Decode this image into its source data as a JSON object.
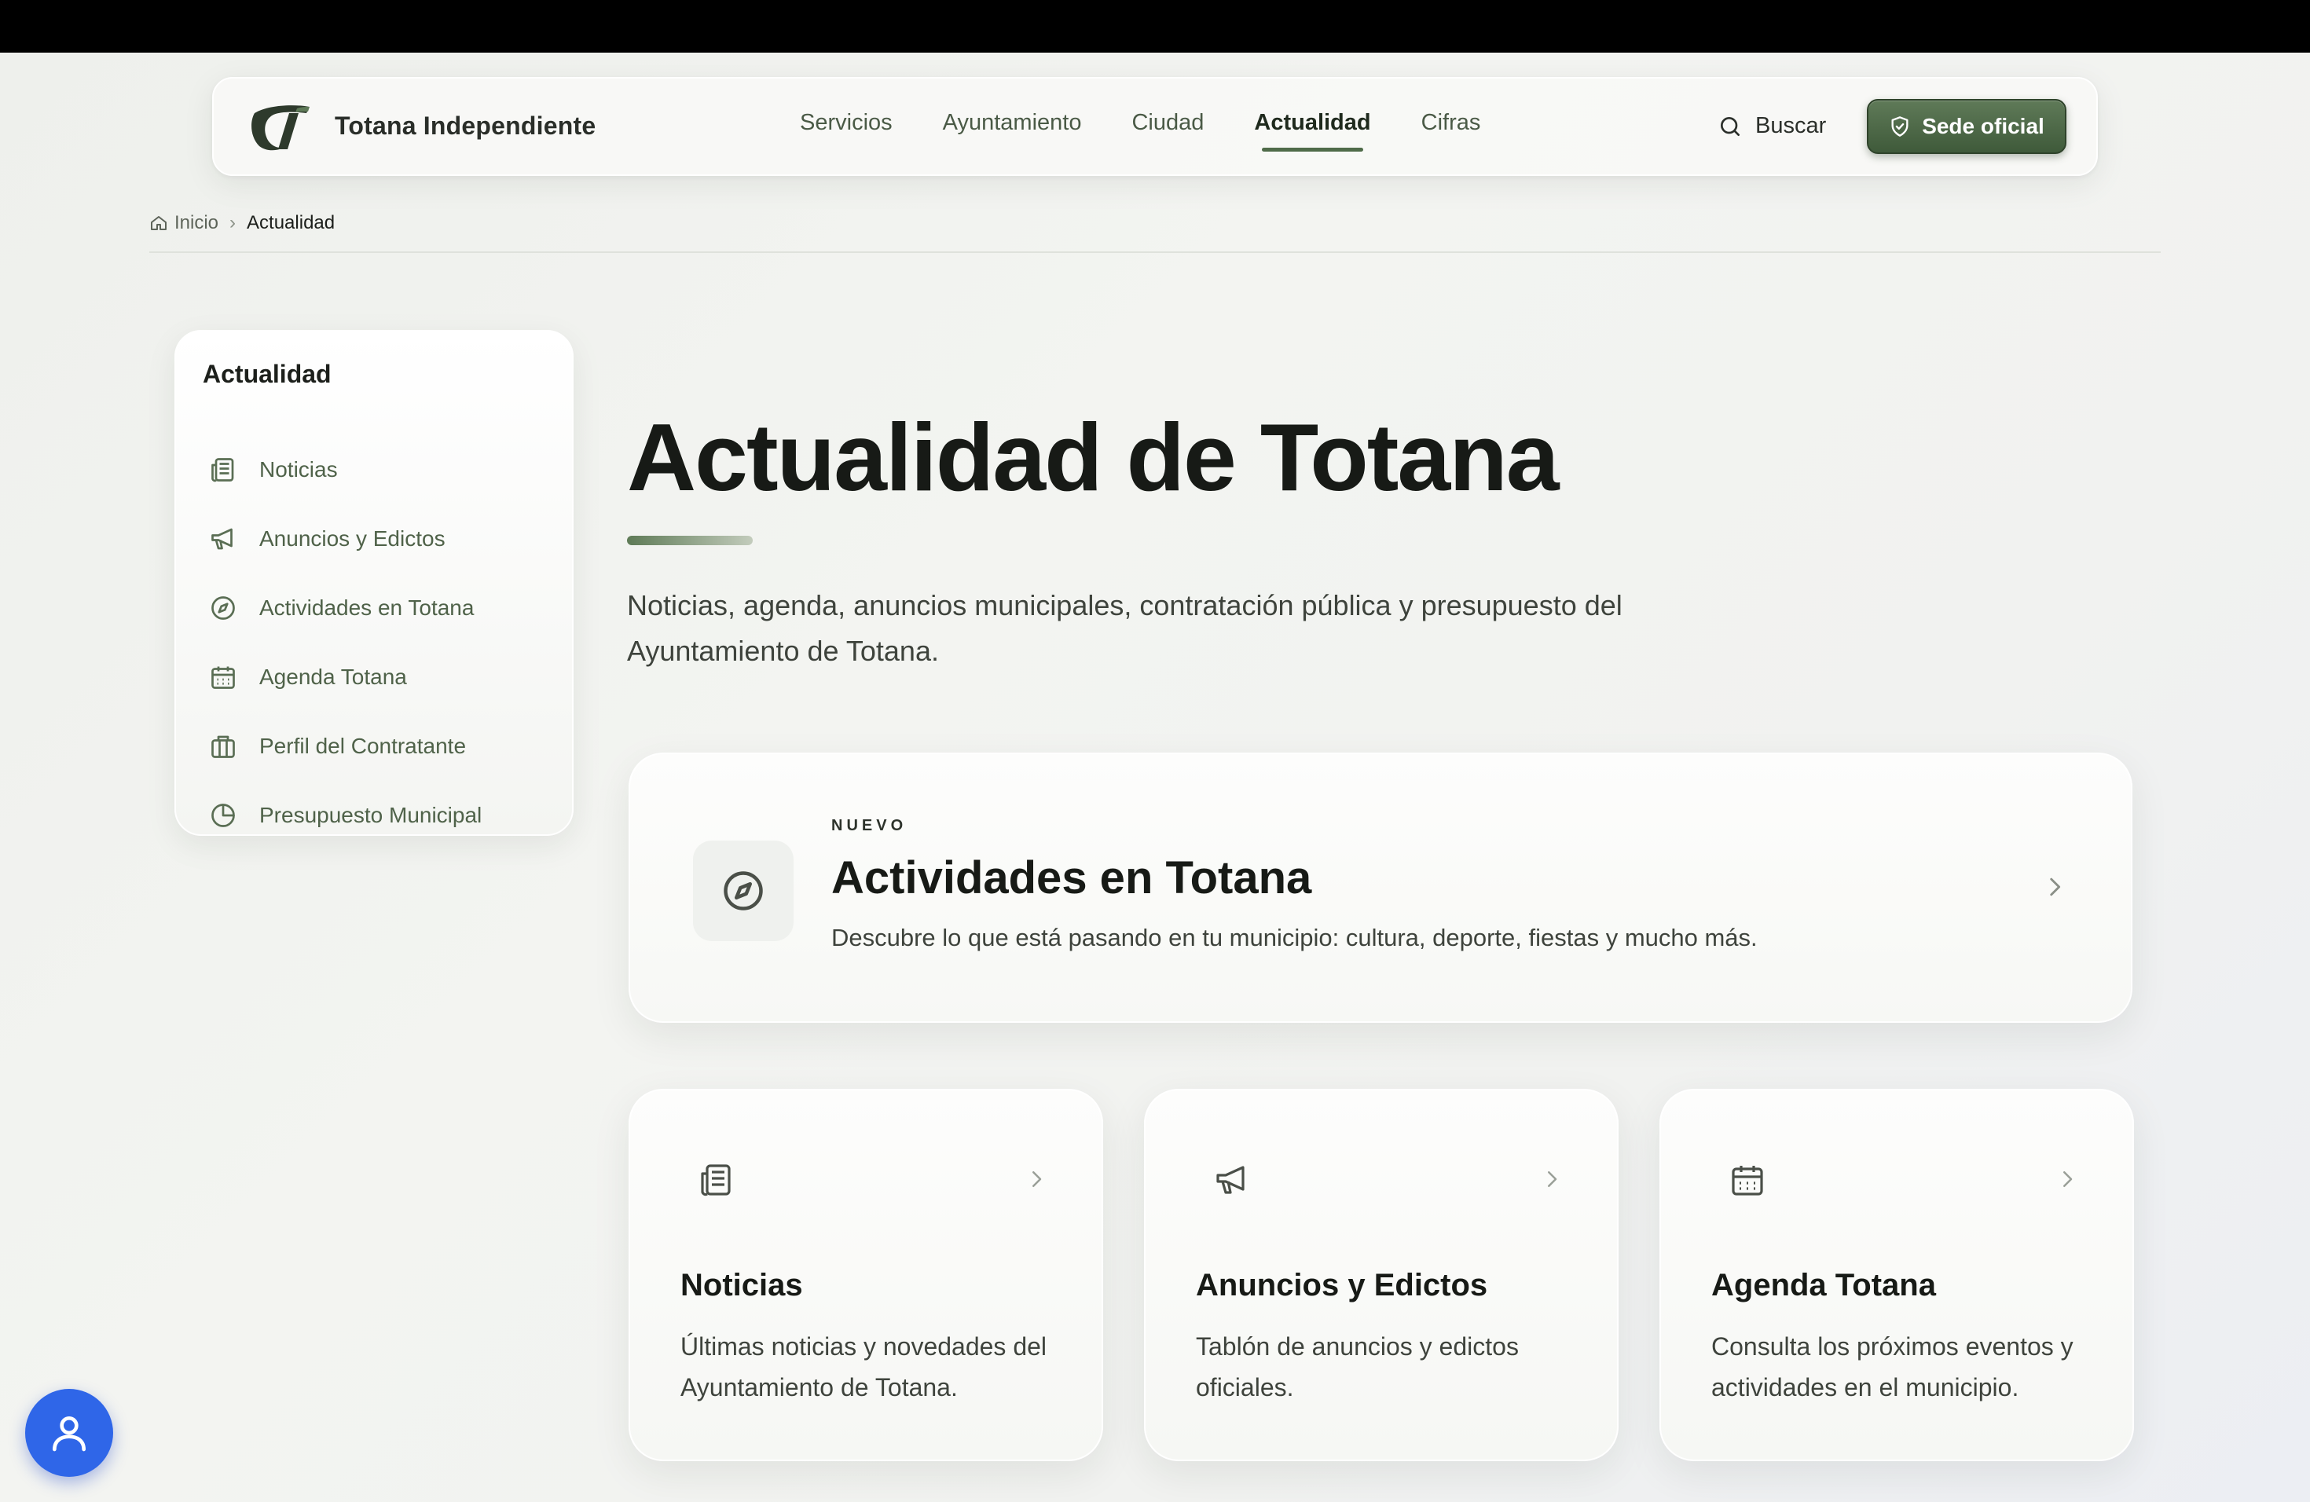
{
  "header": {
    "brand": "Totana Independiente",
    "nav": [
      "Servicios",
      "Ayuntamiento",
      "Ciudad",
      "Actualidad",
      "Cifras"
    ],
    "active_nav": "Actualidad",
    "search_label": "Buscar",
    "sede_label": "Sede oficial"
  },
  "breadcrumb": {
    "home": "Inicio",
    "current": "Actualidad"
  },
  "sidebar": {
    "title": "Actualidad",
    "items": [
      {
        "label": "Noticias",
        "icon": "newspaper-icon"
      },
      {
        "label": "Anuncios y Edictos",
        "icon": "megaphone-icon"
      },
      {
        "label": "Actividades en Totana",
        "icon": "compass-icon"
      },
      {
        "label": "Agenda Totana",
        "icon": "calendar-icon"
      },
      {
        "label": "Perfil del Contratante",
        "icon": "briefcase-icon"
      },
      {
        "label": "Presupuesto Municipal",
        "icon": "pie-chart-icon"
      }
    ]
  },
  "hero": {
    "title": "Actualidad de Totana",
    "subtitle": "Noticias, agenda, anuncios municipales, contratación pública y presupuesto del Ayuntamiento de Totana."
  },
  "feature": {
    "badge": "NUEVO",
    "title": "Actividades en Totana",
    "description": "Descubre lo que está pasando en tu municipio: cultura, deporte, fiestas y mucho más.",
    "icon": "compass-icon"
  },
  "cards": [
    {
      "title": "Noticias",
      "description": "Últimas noticias y novedades del Ayuntamiento de Totana.",
      "icon": "newspaper-icon"
    },
    {
      "title": "Anuncios y Edictos",
      "description": "Tablón de anuncios y edictos oficiales.",
      "icon": "megaphone-icon"
    },
    {
      "title": "Agenda Totana",
      "description": "Consulta los próximos eventos y actividades en el municipio.",
      "icon": "calendar-icon"
    }
  ],
  "colors": {
    "accent": "#4f6b49",
    "button": "#46603f",
    "a11y": "#2f66e8"
  }
}
